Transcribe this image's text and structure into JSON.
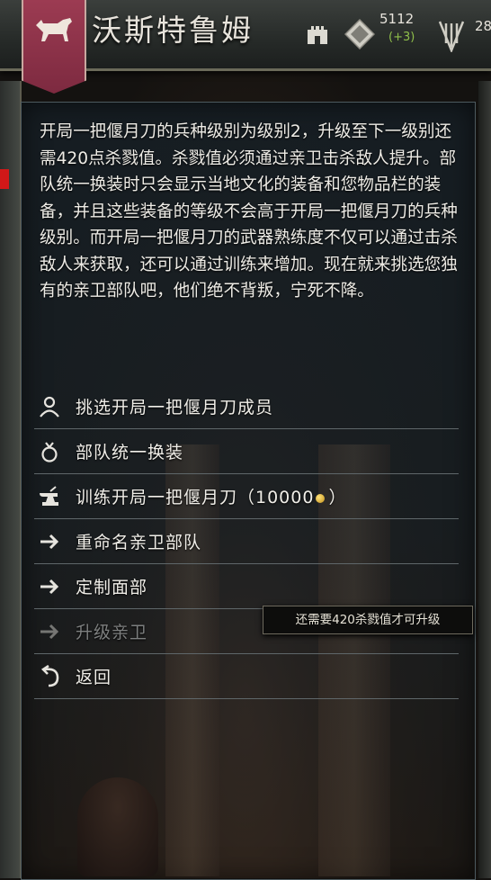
{
  "header": {
    "title": "沃斯特鲁姆",
    "gold_value": "5112",
    "gold_change": "(+3)",
    "troops_value": "28",
    "banner_color": "#9c3b52"
  },
  "panel": {
    "description": "开局一把偃月刀的兵种级别为级别2，升级至下一级别还需420点杀戮值。杀戮值必须通过亲卫击杀敌人提升。部队统一换装时只会显示当地文化的装备和您物品栏的装备，并且这些装备的等级不会高于开局一把偃月刀的兵种级别。而开局一把偃月刀的武器熟练度不仅可以通过击杀敌人来获取，还可以通过训练来增加。现在就来挑选您独有的亲卫部队吧，他们绝不背叛，宁死不降。"
  },
  "menu": {
    "items": [
      {
        "label": "挑选开局一把偃月刀成员",
        "icon": "person-icon",
        "enabled": true
      },
      {
        "label": "部队统一换装",
        "icon": "armor-icon",
        "enabled": true
      },
      {
        "label": "训练开局一把偃月刀（10000",
        "suffix": "）",
        "icon": "anvil-icon",
        "enabled": true
      },
      {
        "label": "重命名亲卫部队",
        "icon": "arrow-right-icon",
        "enabled": true
      },
      {
        "label": "定制面部",
        "icon": "arrow-right-icon",
        "enabled": true
      },
      {
        "label": "升级亲卫",
        "icon": "arrow-right-icon",
        "enabled": false
      },
      {
        "label": "返回",
        "icon": "return-icon",
        "enabled": true
      }
    ],
    "tooltip": "还需要420杀戮值才可升级"
  }
}
